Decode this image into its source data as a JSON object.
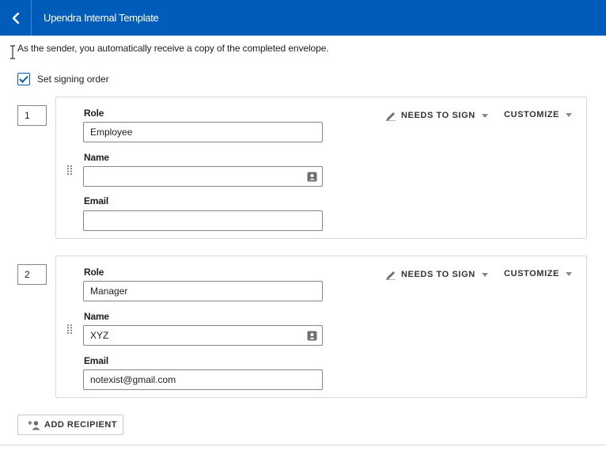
{
  "header": {
    "title": "Upendra Internal Template",
    "back_icon": "chevron-left-icon"
  },
  "note": "As the sender, you automatically receive a copy of the completed envelope.",
  "signing_order": {
    "label": "Set signing order",
    "checked": true
  },
  "labels": {
    "role": "Role",
    "name": "Name",
    "email": "Email"
  },
  "recipients": [
    {
      "order": "1",
      "role": "Employee",
      "name": "",
      "email": "",
      "action": "NEEDS TO SIGN",
      "customize": "CUSTOMIZE"
    },
    {
      "order": "2",
      "role": "Manager",
      "name": "XYZ",
      "email": "notexist@gmail.com",
      "action": "NEEDS TO SIGN",
      "customize": "CUSTOMIZE"
    }
  ],
  "add_recipient_label": "ADD RECIPIENT",
  "colors": {
    "header": "#005cb9",
    "accent": "#005cb9"
  }
}
